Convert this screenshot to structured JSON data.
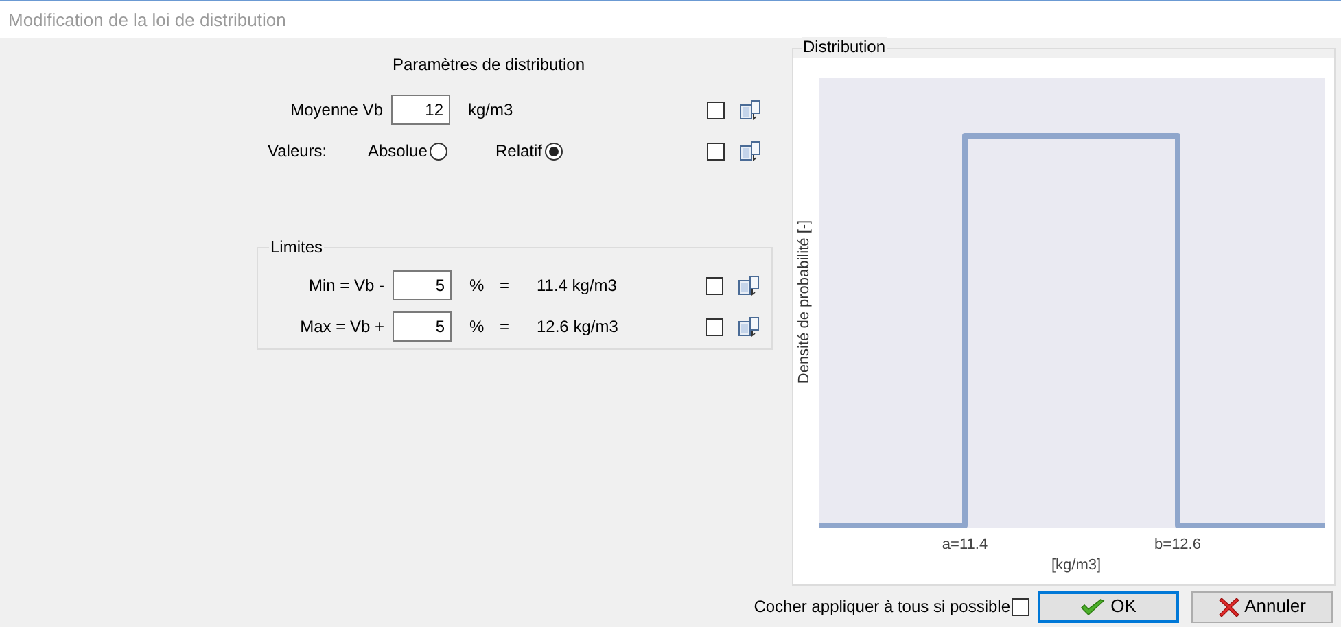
{
  "window": {
    "title": "Modification de la loi de distribution"
  },
  "parameters": {
    "title": "Paramètres de distribution",
    "mean": {
      "label": "Moyenne Vb",
      "value": "12",
      "unit": "kg/m3",
      "checked": false
    },
    "values": {
      "label": "Valeurs:",
      "checked": false,
      "options": [
        {
          "label": "Absolue",
          "selected": false
        },
        {
          "label": "Relatif",
          "selected": true
        }
      ]
    }
  },
  "limits": {
    "title": "Limites",
    "rows": [
      {
        "label": "Min = Vb -",
        "value": "5",
        "unit": "%",
        "equals": "=",
        "result": "11.4 kg/m3",
        "checked": false
      },
      {
        "label": "Max = Vb +",
        "value": "5",
        "unit": "%",
        "equals": "=",
        "result": "12.6 kg/m3",
        "checked": false
      }
    ]
  },
  "distribution": {
    "title": "Distribution",
    "ylabel": "Densité de probabilité [-]",
    "xlabel": "[kg/m3]",
    "tick_labels": [
      "a=11.4",
      "b=12.6"
    ]
  },
  "apply_all": {
    "label": "Cocher appliquer à tous si possible",
    "checked": false
  },
  "buttons": [
    {
      "kind": "ok",
      "label": "OK"
    },
    {
      "kind": "cancel",
      "label": "Annuler"
    }
  ]
}
